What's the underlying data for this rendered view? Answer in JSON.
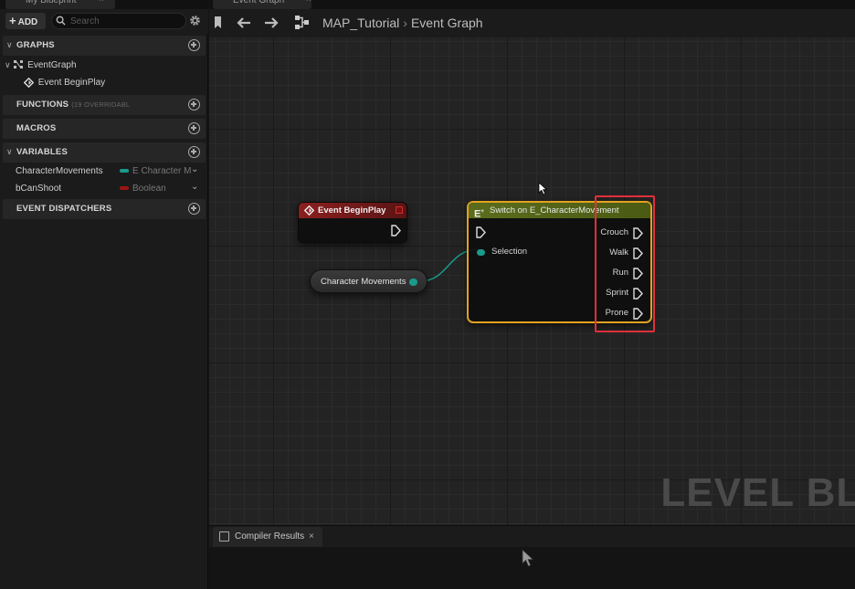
{
  "left_panel": {
    "tab_title": "My Blueprint",
    "add_label": "ADD",
    "search_placeholder": "Search",
    "sections": {
      "graphs": "GRAPHS",
      "functions": "FUNCTIONS",
      "functions_note": "(19 OVERRIDABL",
      "macros": "MACROS",
      "variables": "VARIABLES",
      "event_dispatchers": "EVENT DISPATCHERS"
    },
    "graph_items": {
      "event_graph": "EventGraph",
      "event_begin_play": "Event BeginPlay"
    },
    "variables": [
      {
        "name": "CharacterMovements",
        "type": "E Character M",
        "color": "#1a9a8c"
      },
      {
        "name": "bCanShoot",
        "type": "Boolean",
        "color": "#9a1515"
      }
    ]
  },
  "main": {
    "tab_title": "Event Graph",
    "breadcrumb": {
      "root": "MAP_Tutorial",
      "current": "Event Graph"
    },
    "watermark": "LEVEL BLU"
  },
  "nodes": {
    "begin_play": {
      "title": "Event BeginPlay",
      "color": "#8b1f1f"
    },
    "variable": {
      "label": "Character Movements",
      "pin_color": "#1a9a8c"
    },
    "switch": {
      "title": "Switch on E_CharacterMovement",
      "input_label": "Selection",
      "outputs": [
        "Crouch",
        "Walk",
        "Run",
        "Sprint",
        "Prone"
      ],
      "border_color": "#e2a21e"
    }
  },
  "highlight_color": "#e0303a",
  "bottom": {
    "tab_title": "Compiler Results"
  }
}
